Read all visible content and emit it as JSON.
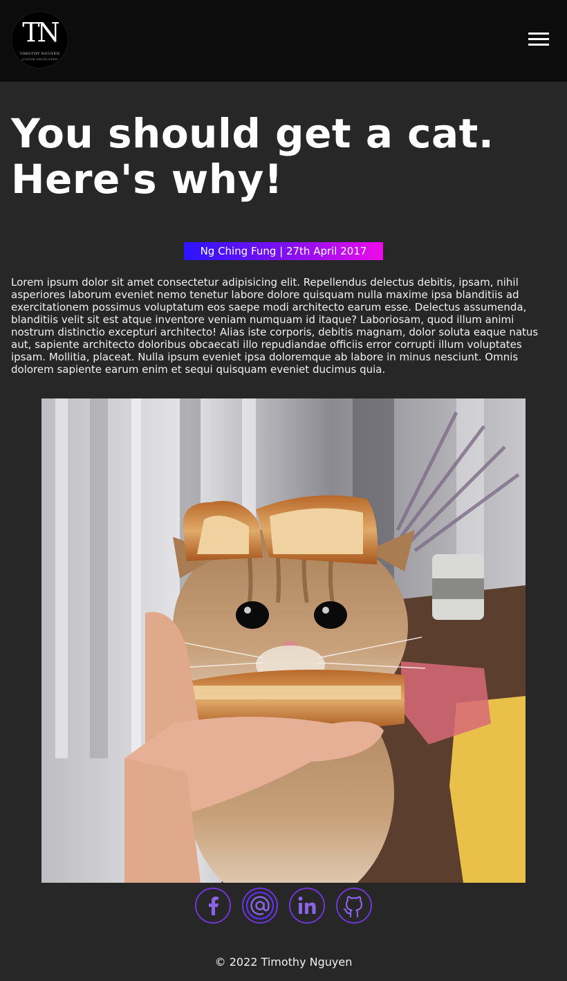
{
  "header": {
    "logo": {
      "monogram": "TN",
      "name": "TIMOTHY NGUYEN",
      "role": "JUNIOR DEVELOPER"
    },
    "menu_icon": "hamburger-menu-icon"
  },
  "article": {
    "title": "You should get a cat. Here's why!",
    "byline": "Ng Ching Fung | 27th April 2017",
    "body": "Lorem ipsum dolor sit amet consectetur adipisicing elit. Repellendus delectus debitis, ipsam, nihil asperiores laborum eveniet nemo tenetur labore dolore quisquam nulla maxime ipsa blanditiis ad exercitationem possimus voluptatum eos saepe modi architecto earum esse. Delectus assumenda, blanditiis velit sit est atque inventore veniam numquam id itaque? Laboriosam, quod illum animi nostrum distinctio excepturi architecto! Alias iste corporis, debitis magnam, dolor soluta eaque natus aut, sapiente architecto doloribus obcaecati illo repudiandae officiis error corrupti illum voluptates ipsam. Mollitia, placeat. Nulla ipsum eveniet ipsa doloremque ab labore in minus nesciunt. Omnis dolorem sapiente earum enim et sequi quisquam eveniet ducimus quia."
  },
  "social": [
    {
      "icon": "facebook-icon"
    },
    {
      "icon": "at-sign-email-icon"
    },
    {
      "icon": "linkedin-icon"
    },
    {
      "icon": "github-icon"
    }
  ],
  "footer": {
    "copyright": "© 2022 Timothy Nguyen"
  },
  "colors": {
    "page_bg": "#272727",
    "header_bg": "#0c0c0c",
    "byline_gradient_start": "#2d14ff",
    "byline_gradient_end": "#ee0be8",
    "social_icon_start": "#3b1cf0",
    "social_icon_end": "#c71ee8"
  }
}
